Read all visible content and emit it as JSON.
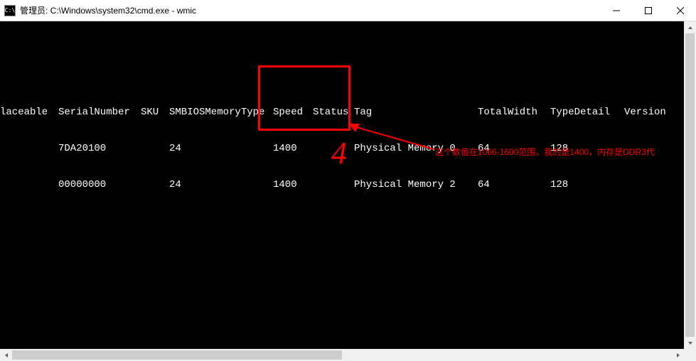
{
  "window": {
    "icon_label": "C:\\",
    "title": "管理员: C:\\Windows\\system32\\cmd.exe - wmic"
  },
  "columns": {
    "laceable": "laceable",
    "serial": "SerialNumber",
    "sku": "SKU",
    "smbios": "SMBIOSMemoryType",
    "speed": "Speed",
    "status": "Status",
    "tag": "Tag",
    "totalwidth": "TotalWidth",
    "typedetail": "TypeDetail",
    "version": "Version"
  },
  "rows": [
    {
      "laceable": "",
      "serial": "7DA20100",
      "sku": "",
      "smbios": "24",
      "speed": "1400",
      "status": "",
      "tag": "Physical Memory 0",
      "totalwidth": "64",
      "typedetail": "128",
      "version": ""
    },
    {
      "laceable": "",
      "serial": "00000000",
      "sku": "",
      "smbios": "24",
      "speed": "1400",
      "status": "",
      "tag": "Physical Memory 2",
      "totalwidth": "64",
      "typedetail": "128",
      "version": ""
    }
  ],
  "annotation": {
    "number": "4",
    "text": "这个数值在1066-1600范围，我的是1400，内存是DDR3代"
  },
  "chart_data": {
    "type": "table",
    "columns": [
      "laceable",
      "SerialNumber",
      "SKU",
      "SMBIOSMemoryType",
      "Speed",
      "Status",
      "Tag",
      "TotalWidth",
      "TypeDetail",
      "Version"
    ],
    "rows": [
      [
        "",
        "7DA20100",
        "",
        "24",
        "1400",
        "",
        "Physical Memory 0",
        "64",
        "128",
        ""
      ],
      [
        "",
        "00000000",
        "",
        "24",
        "1400",
        "",
        "Physical Memory 2",
        "64",
        "128",
        ""
      ]
    ]
  }
}
